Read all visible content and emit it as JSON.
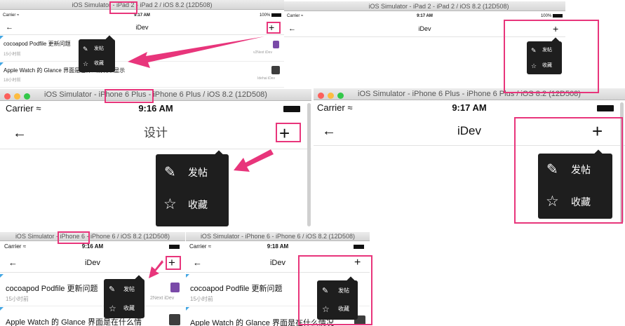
{
  "ipad_left": {
    "window_title": "iOS Simulator - iPad 2 - iPad 2 / iOS 8.2 (12D508)",
    "carrier": "Carrier",
    "time": "9:17 AM",
    "battery": "100%",
    "nav_title": "iDev",
    "back": "←",
    "plus": "+",
    "popup": {
      "post": "发帖",
      "favorite": "收藏"
    },
    "rows": [
      {
        "title": "cocoapod Podfile 更新问题",
        "meta": "15小时前",
        "source": "v2Next  iDev"
      },
      {
        "title": "Apple Watch 的 Glance 界面是在什么情况下显示",
        "meta": "18小时前",
        "source": "Idehai  iDev"
      }
    ]
  },
  "ipad_right": {
    "window_title": "iOS Simulator - iPad 2 - iPad 2 / iOS 8.2 (12D508)",
    "carrier": "Carrier",
    "time": "9:17 AM",
    "battery": "100%",
    "nav_title": "iDev",
    "back": "←",
    "plus": "+",
    "popup": {
      "post": "发帖",
      "favorite": "收藏"
    }
  },
  "iphone6plus_left": {
    "window_title": "iOS Simulator - iPhone 6 Plus - iPhone 6 Plus / iOS 8.2 (12D508)",
    "carrier": "Carrier",
    "time": "9:16 AM",
    "nav_title": "设计",
    "back": "←",
    "plus": "+",
    "popup": {
      "post": "发帖",
      "favorite": "收藏"
    }
  },
  "iphone6plus_right": {
    "window_title": "iOS Simulator - iPhone 6 Plus - iPhone 6 Plus / iOS 8.2 (12D508)",
    "carrier": "Carrier",
    "time": "9:17 AM",
    "nav_title": "iDev",
    "back": "←",
    "plus": "+",
    "popup": {
      "post": "发帖",
      "favorite": "收藏"
    }
  },
  "iphone6_left": {
    "window_title": "iOS Simulator - iPhone 6 - iPhone 6 / iOS 8.2 (12D508)",
    "carrier": "Carrier",
    "time": "9:16 AM",
    "nav_title": "iDev",
    "back": "←",
    "plus": "+",
    "popup": {
      "post": "发帖",
      "favorite": "收藏"
    },
    "rows": [
      {
        "title": "cocoapod Podfile 更新问题",
        "meta": "15小时前",
        "source": "2Next  iDev"
      },
      {
        "title": "Apple Watch 的 Glance 界面是在什么情",
        "meta": "",
        "source": ""
      }
    ]
  },
  "iphone6_right": {
    "window_title": "iOS Simulator - iPhone 6 - iPhone 6 / iOS 8.2 (12D508)",
    "carrier": "Carrier",
    "time": "9:18 AM",
    "nav_title": "iDev",
    "back": "←",
    "plus": "+",
    "popup": {
      "post": "发帖",
      "favorite": "收藏"
    },
    "rows": [
      {
        "title": "cocoapod Podfile 更新问题",
        "meta": "15小时前"
      },
      {
        "title": "Apple Watch 的 Glance 界面是在什么情况",
        "meta": ""
      }
    ]
  },
  "colors": {
    "highlight": "#e8357b",
    "popup_bg": "#1e1e1e",
    "traffic_red": "#fc605c",
    "traffic_yellow": "#fdbc40",
    "traffic_green": "#34c84a",
    "unread_corner": "#43a6e3"
  },
  "icons": {
    "back": "left-arrow-icon",
    "plus": "plus-icon",
    "post": "compose-icon",
    "favorite": "star-icon",
    "wifi": "wifi-icon",
    "battery": "battery-icon"
  }
}
